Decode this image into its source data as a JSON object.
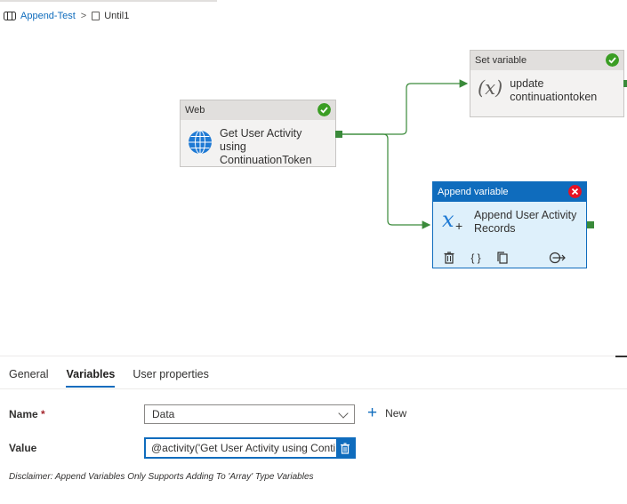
{
  "breadcrumb": {
    "pipeline": "Append-Test",
    "separator": ">",
    "current": "Until1"
  },
  "canvas": {
    "web_node": {
      "type": "Web",
      "title_line1": "Get User Activity using",
      "title_line2": "ContinuationToken",
      "status": "success"
    },
    "set_node": {
      "type": "Set variable",
      "title_line1": "update",
      "title_line2": "continuationtoken",
      "status": "success"
    },
    "append_node": {
      "type": "Append variable",
      "title_line1": "Append User Activity",
      "title_line2": "Records",
      "status": "error",
      "toolbar_icons": [
        "delete-icon",
        "code-icon",
        "copy-icon",
        "add-output-icon"
      ]
    }
  },
  "tabs": [
    {
      "label": "General",
      "active": false
    },
    {
      "label": "Variables",
      "active": true
    },
    {
      "label": "User properties",
      "active": false
    }
  ],
  "form": {
    "name_label": "Name",
    "required_mark": "*",
    "name_value": "Data",
    "new_label": "New",
    "value_label": "Value",
    "value_text": "@activity('Get User Activity using Contin"
  },
  "disclaimer": "Disclaimer: Append Variables Only Supports Adding To 'Array' Type Variables",
  "colors": {
    "accent": "#0f6cbd",
    "success": "#3a9d23",
    "error": "#e81123",
    "connector": "#3a8a3a",
    "selected_node_bg": "#def0fb"
  }
}
